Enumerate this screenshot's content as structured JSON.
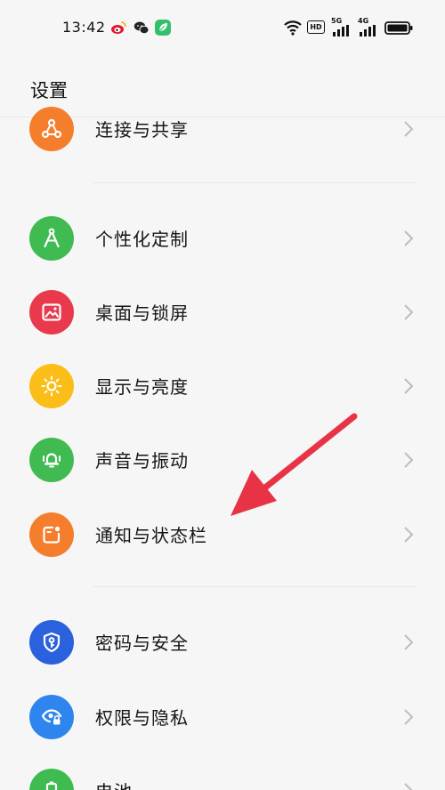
{
  "status_bar": {
    "time": "13:42",
    "apps": [
      "weibo-icon",
      "wechat-icon",
      "leaf-app-icon"
    ],
    "indicators": [
      "wifi-icon",
      "hd-icon",
      "signal-5g-icon",
      "signal-4g-icon",
      "battery-icon"
    ],
    "hd_label": "HD",
    "net1_label": "5G",
    "net2_label": "4G"
  },
  "header": {
    "title": "设置"
  },
  "settings": [
    {
      "label": "连接与共享",
      "icon": "share-icon",
      "color": "#f57e2c"
    },
    {
      "label": "个性化定制",
      "icon": "compass-icon",
      "color": "#3fbb51"
    },
    {
      "label": "桌面与锁屏",
      "icon": "picture-icon",
      "color": "#e83a4c"
    },
    {
      "label": "显示与亮度",
      "icon": "sun-icon",
      "color": "#fbbd17"
    },
    {
      "label": "声音与振动",
      "icon": "bell-icon",
      "color": "#3fbb51"
    },
    {
      "label": "通知与状态栏",
      "icon": "notification-icon",
      "color": "#f57e2c"
    },
    {
      "label": "密码与安全",
      "icon": "shield-key-icon",
      "color": "#2a61dc"
    },
    {
      "label": "权限与隐私",
      "icon": "eye-lock-icon",
      "color": "#2e85ee"
    },
    {
      "label": "电池",
      "icon": "battery-setting-icon",
      "color": "#3fbb51"
    }
  ],
  "annotation": {
    "color": "#e83346"
  }
}
